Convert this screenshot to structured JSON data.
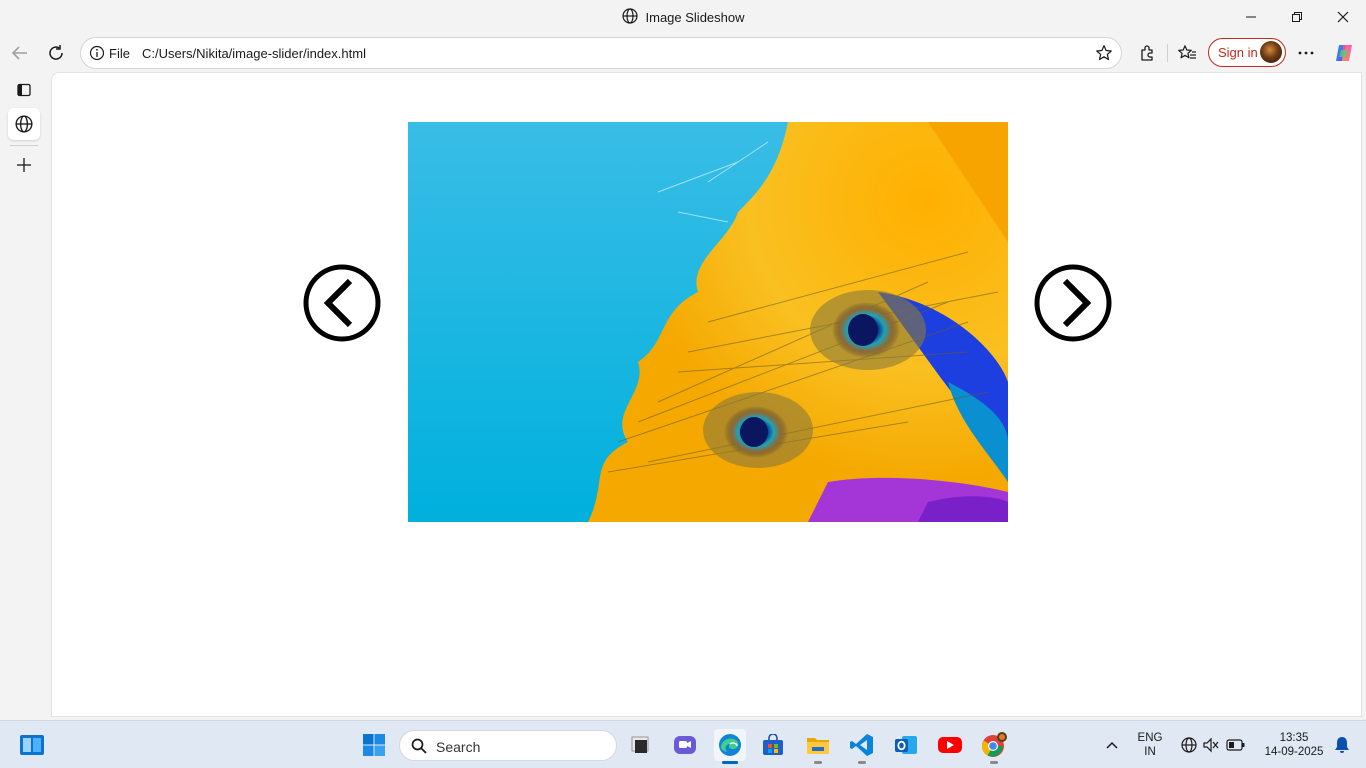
{
  "window": {
    "title": "Image Slideshow"
  },
  "addressbar": {
    "scheme_label": "File",
    "url": "C:/Users/Nikita/image-slider/index.html"
  },
  "toolbar": {
    "signin_label": "Sign in"
  },
  "slideshow": {
    "prev_icon": "chevron-left-circle-icon",
    "next_icon": "chevron-right-circle-icon",
    "image_subject": "peacock-feathers"
  },
  "taskbar": {
    "search_label": "Search",
    "language_line1": "ENG",
    "language_line2": "IN",
    "time": "13:35",
    "date": "14-09-2025"
  },
  "colors": {
    "accent": "#0067c0",
    "signin_red": "#c42b1c",
    "slide_sky": "#0fb4de"
  }
}
